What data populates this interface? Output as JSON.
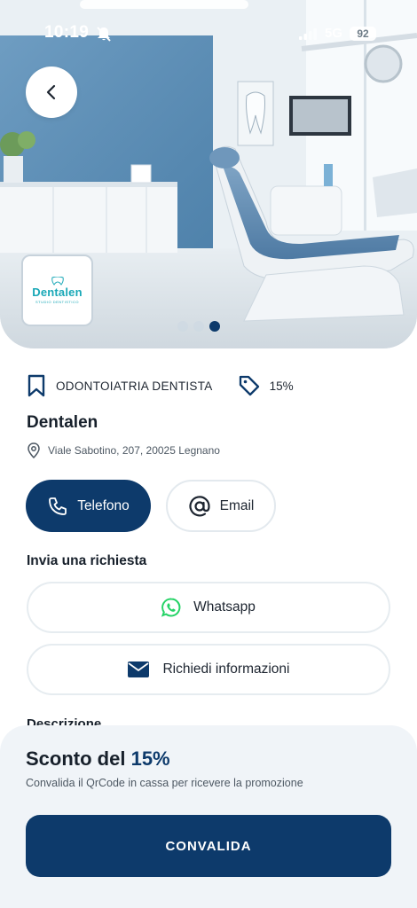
{
  "status_bar": {
    "time": "10:19",
    "network": "5G",
    "battery": "92"
  },
  "hero": {
    "logo_text": "Dentalen",
    "logo_subtext": "STUDIO DENTISTICO",
    "slides": 3,
    "active_slide": 3
  },
  "category": {
    "label": "ODONTOIATRIA DENTISTA",
    "discount": "15%"
  },
  "business": {
    "name": "Dentalen",
    "address": "Viale Sabotino, 207, 20025 Legnano"
  },
  "contact": {
    "phone_label": "Telefono",
    "email_label": "Email"
  },
  "request": {
    "title": "Invia una richiesta",
    "whatsapp_label": "Whatsapp",
    "info_label": "Richiedi informazioni"
  },
  "description": {
    "title": "Descrizione"
  },
  "promo": {
    "title_prefix": "Sconto del",
    "title_value": "15%",
    "subtitle": "Convalida il QrCode in cassa per ricevere la promozione",
    "button_label": "CONVALIDA"
  },
  "colors": {
    "primary": "#0d3a6b",
    "whatsapp": "#25d366",
    "sheet_bg": "#f0f4f8"
  }
}
